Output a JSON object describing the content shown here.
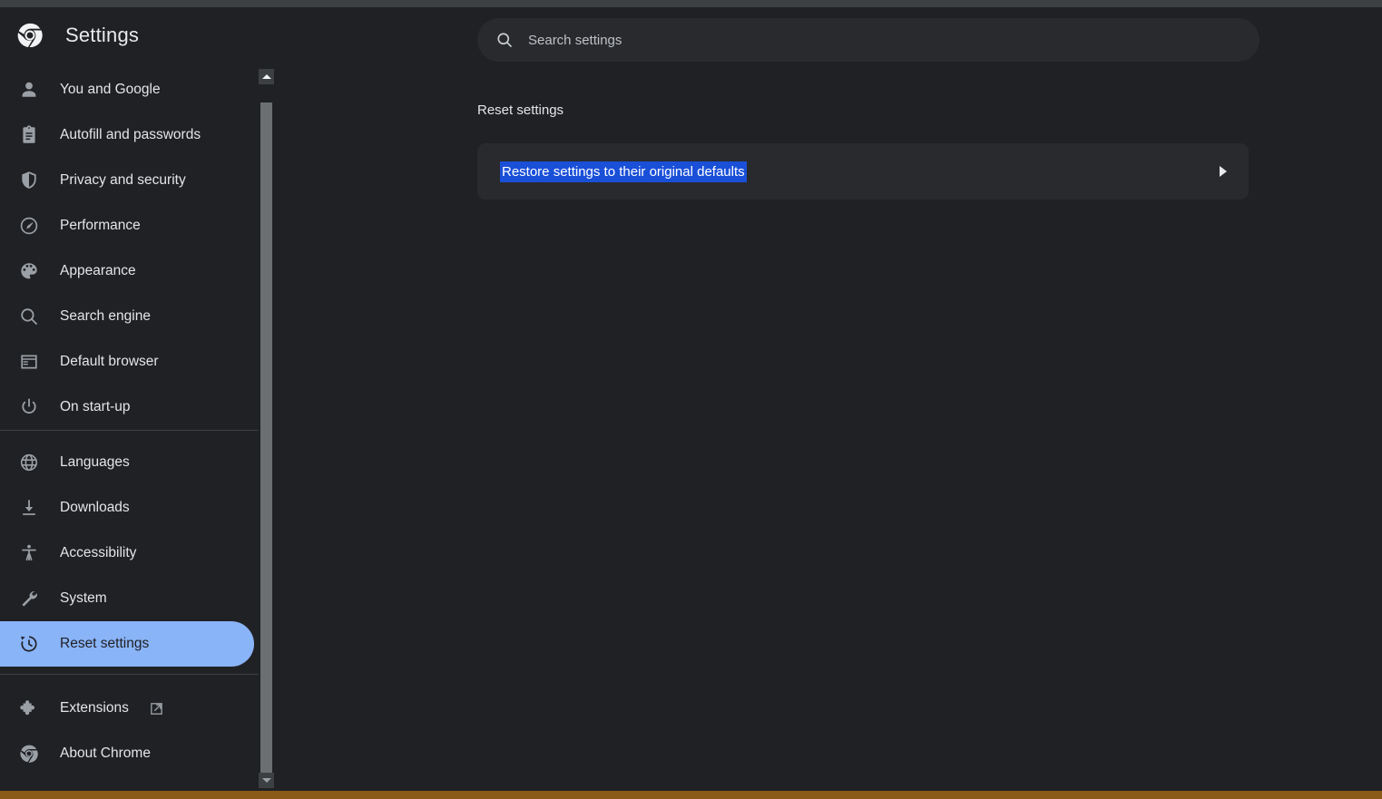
{
  "window": {
    "top_strip_color": "#3c4043",
    "bottom_strip_color": "#8a5a18",
    "background_color": "#202124"
  },
  "sidebar": {
    "brand": {
      "logo_icon": "chrome-logo-icon",
      "title": "Settings"
    },
    "selected_item": "Reset settings",
    "selected_color": "#8ab4f8",
    "groups": [
      {
        "name": "primary",
        "items": [
          {
            "label": "You and Google",
            "icon": "person-icon"
          },
          {
            "label": "Autofill and passwords",
            "icon": "clipboard-icon"
          },
          {
            "label": "Privacy and security",
            "icon": "shield-icon"
          },
          {
            "label": "Performance",
            "icon": "speedometer-icon"
          },
          {
            "label": "Appearance",
            "icon": "palette-icon"
          },
          {
            "label": "Search engine",
            "icon": "search-icon"
          },
          {
            "label": "Default browser",
            "icon": "browser-window-icon"
          },
          {
            "label": "On start-up",
            "icon": "power-icon"
          }
        ]
      },
      {
        "name": "advanced",
        "items": [
          {
            "label": "Languages",
            "icon": "globe-icon"
          },
          {
            "label": "Downloads",
            "icon": "download-icon"
          },
          {
            "label": "Accessibility",
            "icon": "accessibility-icon"
          },
          {
            "label": "System",
            "icon": "wrench-icon"
          },
          {
            "label": "Reset settings",
            "icon": "history-restore-icon"
          }
        ]
      },
      {
        "name": "footer",
        "items": [
          {
            "label": "Extensions",
            "icon": "puzzle-piece-icon",
            "external_icon": "open-in-new-icon"
          },
          {
            "label": "About Chrome",
            "icon": "chrome-logo-icon"
          }
        ]
      }
    ],
    "scrollbar": {
      "up_arrow_icon": "scroll-up-arrow-icon",
      "down_arrow_icon": "scroll-down-arrow-icon"
    }
  },
  "main": {
    "search": {
      "icon": "search-icon",
      "placeholder": "Search settings",
      "value": ""
    },
    "section": {
      "title": "Reset settings"
    },
    "card": {
      "label": "Restore settings to their original defaults",
      "label_selected": true,
      "selection_color": "#1a4fd8",
      "arrow_icon": "chevron-right-icon"
    }
  }
}
